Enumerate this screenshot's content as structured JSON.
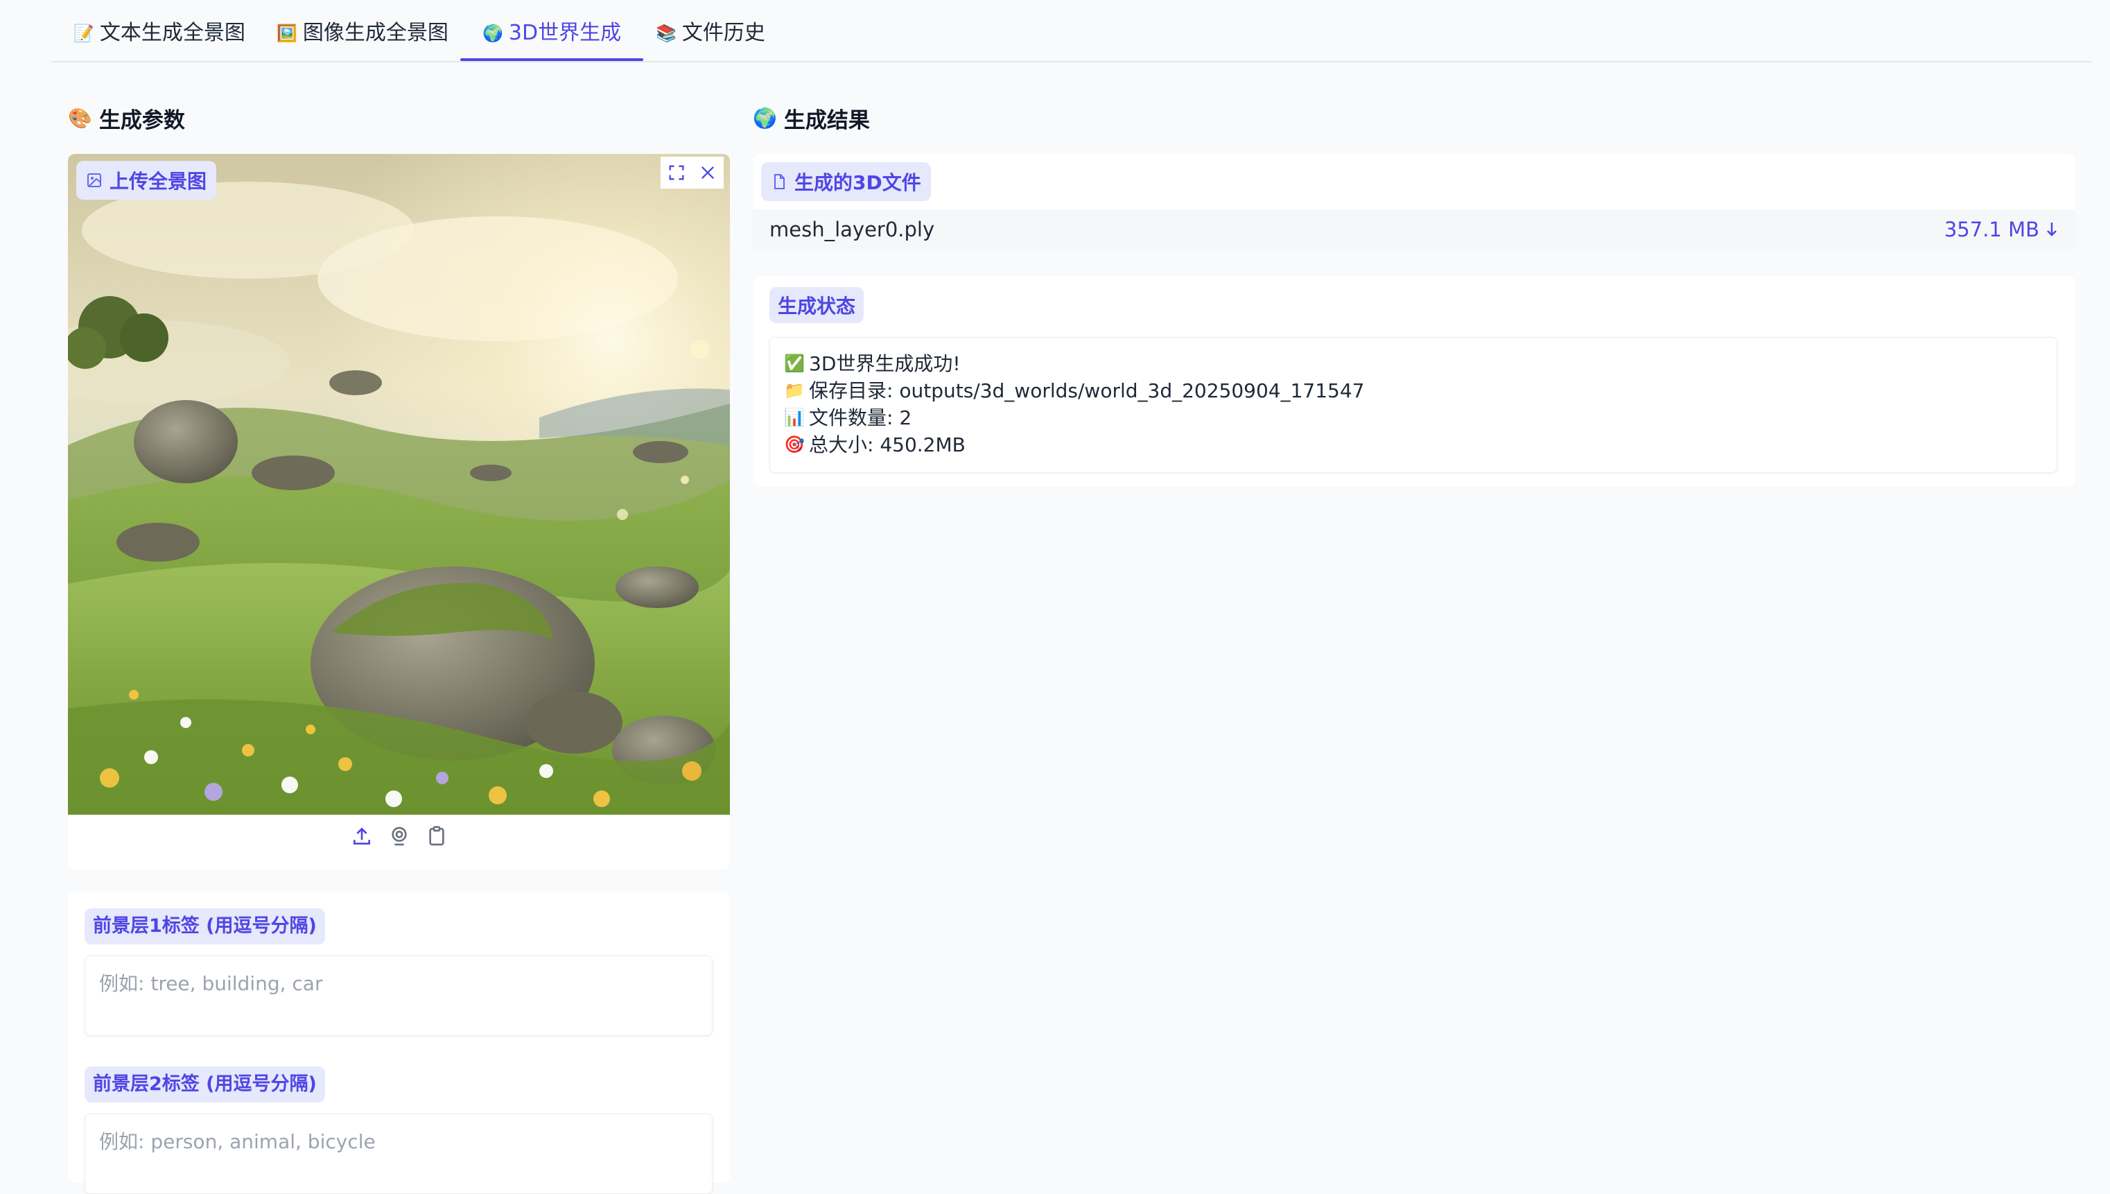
{
  "tabs": [
    {
      "icon": "📝",
      "label": "文本生成全景图",
      "active": false
    },
    {
      "icon": "🖼️",
      "label": "图像生成全景图",
      "active": false
    },
    {
      "icon": "🌍",
      "label": "3D世界生成",
      "active": true
    },
    {
      "icon": "📚",
      "label": "文件历史",
      "active": false
    }
  ],
  "left": {
    "heading_icon": "🎨",
    "heading": "生成参数",
    "upload_label": "上传全景图",
    "fields": [
      {
        "label": "前景层1标签 (用逗号分隔)",
        "placeholder": "例如: tree, building, car"
      },
      {
        "label": "前景层2标签 (用逗号分隔)",
        "placeholder": "例如: person, animal, bicycle"
      }
    ]
  },
  "right": {
    "heading_icon": "🌍",
    "heading": "生成结果",
    "file_label": "生成的3D文件",
    "file": {
      "name": "mesh_layer0.ply",
      "size": "357.1 MB"
    },
    "status_label": "生成状态",
    "status_lines": [
      {
        "icon": "✅",
        "text": "3D世界生成成功!"
      },
      {
        "icon": "📁",
        "text": "保存目录: outputs/3d_worlds/world_3d_20250904_171547"
      },
      {
        "icon": "📊",
        "text": "文件数量: 2"
      },
      {
        "icon": "🎯",
        "text": "总大小: 450.2MB"
      }
    ]
  },
  "colors": {
    "accent": "#4f46e5",
    "badge_bg": "#e6e8fb",
    "page_bg": "#f9fafb"
  },
  "icons": [
    "image-icon",
    "fullscreen-icon",
    "close-icon",
    "upload-icon",
    "webcam-icon",
    "clipboard-icon",
    "file-icon",
    "download-arrow-icon"
  ]
}
